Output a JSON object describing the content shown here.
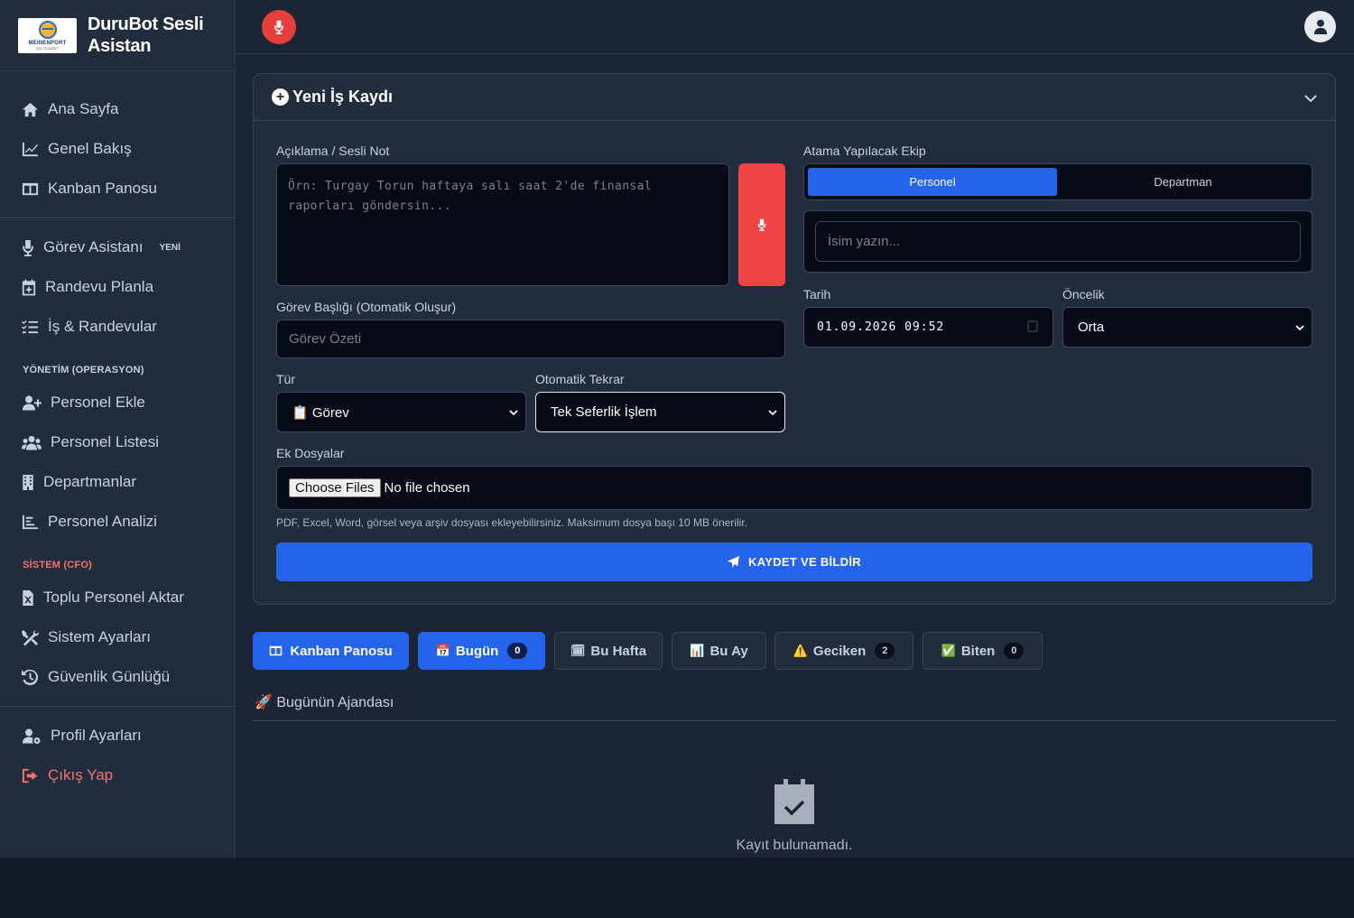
{
  "brand": {
    "title": "DuruBot Sesli Asistan",
    "logo_text": "MEINENPORT",
    "logo_sub": "DIŞ TİCARET"
  },
  "sidebar": {
    "main": [
      {
        "label": "Ana Sayfa",
        "icon": "home-icon"
      },
      {
        "label": "Genel Bakış",
        "icon": "chart-line-icon"
      },
      {
        "label": "Kanban Panosu",
        "icon": "columns-icon"
      }
    ],
    "assistant": [
      {
        "label": "Görev Asistanı",
        "icon": "microphone-icon",
        "badge": "YENİ"
      },
      {
        "label": "Randevu Planla",
        "icon": "calendar-plus-icon"
      },
      {
        "label": "İş & Randevular",
        "icon": "list-check-icon"
      }
    ],
    "management_title": "YÖNETİM (OPERASYON)",
    "management": [
      {
        "label": "Personel Ekle",
        "icon": "user-plus-icon"
      },
      {
        "label": "Personel Listesi",
        "icon": "users-icon"
      },
      {
        "label": "Departmanlar",
        "icon": "building-icon"
      },
      {
        "label": "Personel Analizi",
        "icon": "chart-bar-icon"
      }
    ],
    "system_title": "SİSTEM (CFO)",
    "system_title_color": "#f87171",
    "system": [
      {
        "label": "Toplu Personel Aktar",
        "icon": "file-excel-icon"
      },
      {
        "label": "Sistem Ayarları",
        "icon": "tools-icon"
      },
      {
        "label": "Güvenlik Günlüğü",
        "icon": "history-icon"
      }
    ],
    "footer": [
      {
        "label": "Profil Ayarları",
        "icon": "user-gear-icon"
      },
      {
        "label": "Çıkış Yap",
        "icon": "sign-out-icon",
        "color": "#f87171"
      }
    ]
  },
  "form": {
    "title": "Yeni İş Kaydı",
    "description_label": "Açıklama / Sesli Not",
    "description_placeholder": "Örn: Turgay Torun haftaya salı saat 2'de finansal raporları göndersin...",
    "task_title_label": "Görev Başlığı (Otomatik Oluşur)",
    "task_title_placeholder": "Görev Özeti",
    "type_label": "Tür",
    "type_value": "📋 Görev",
    "repeat_label": "Otomatik Tekrar",
    "repeat_value": "Tek Seferlik İşlem",
    "assign_label": "Atama Yapılacak Ekip",
    "assign_tabs": [
      "Personel",
      "Departman"
    ],
    "name_placeholder": "İsim yazın...",
    "date_label": "Tarih",
    "date_value": "01.09.2026 09:52",
    "priority_label": "Öncelik",
    "priority_value": "Orta",
    "files_label": "Ek Dosyalar",
    "choose_files": "Choose Files",
    "no_file": "No file chosen",
    "files_hint": "PDF, Excel, Word, görsel veya arşiv dosyası ekleyebilirsiniz. Maksimum dosya başı 10 MB önerilir.",
    "save_label": "KAYDET VE BİLDİR"
  },
  "tabs": [
    {
      "label": "Kanban Panosu",
      "icon": "columns-icon"
    },
    {
      "label": "Bugün",
      "icon": "📅",
      "count": "0"
    },
    {
      "label": "Bu Hafta",
      "icon": "🗓"
    },
    {
      "label": "Bu Ay",
      "icon": "📊"
    },
    {
      "label": "Geciken",
      "icon": "⚠️",
      "count": "2"
    },
    {
      "label": "Biten",
      "icon": "✅",
      "count": "0"
    }
  ],
  "agenda": {
    "title": "🚀 Bugünün Ajandası",
    "empty_text": "Kayıt bulunamadı."
  },
  "colors": {
    "accent": "#2563eb",
    "danger": "#ef4444",
    "background": "#1b2535",
    "panel": "#212d3d"
  }
}
